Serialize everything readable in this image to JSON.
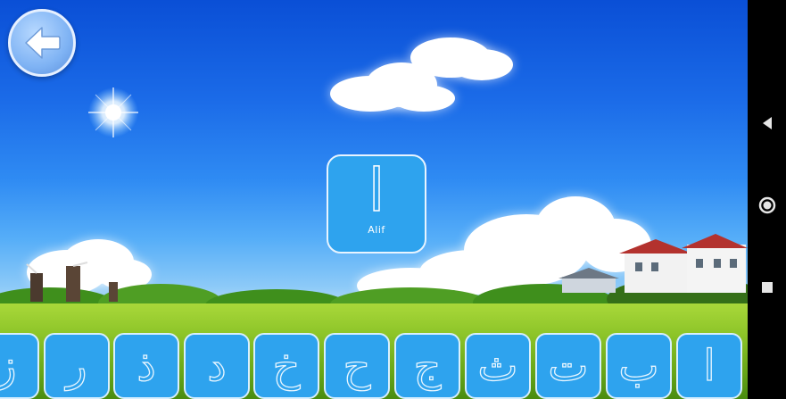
{
  "current_letter": {
    "glyph": "ا",
    "name": "Alif"
  },
  "tiles": [
    {
      "glyph": "ز"
    },
    {
      "glyph": "ر"
    },
    {
      "glyph": "ذ"
    },
    {
      "glyph": "د"
    },
    {
      "glyph": "خ"
    },
    {
      "glyph": "ح"
    },
    {
      "glyph": "ج"
    },
    {
      "glyph": "ث"
    },
    {
      "glyph": "ت"
    },
    {
      "glyph": "ب"
    },
    {
      "glyph": "ا"
    }
  ],
  "icons": {
    "back": "arrow-left-icon",
    "nav_back": "triangle-back-icon",
    "nav_home": "circle-home-icon",
    "nav_recents": "square-recents-icon"
  },
  "colors": {
    "tile_fill": "#2ea3ee",
    "tile_border": "#d8efff",
    "nav_bar": "#000000"
  }
}
